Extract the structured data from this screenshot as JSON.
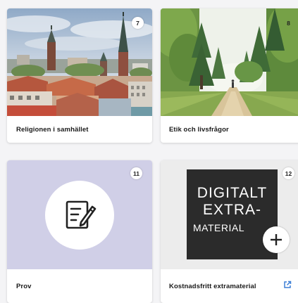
{
  "cards": [
    {
      "number": "7",
      "title": "Religionen i samhället",
      "image": "city-skyline-photo"
    },
    {
      "number": "8",
      "title": "Etik och livsfrågor",
      "image": "forest-path-photo"
    },
    {
      "number": "11",
      "title": "Prov",
      "icon": "exam-edit-icon",
      "media_color": "#d0cfe7"
    },
    {
      "number": "12",
      "title": "Kostnadsfritt extramaterial",
      "badge": {
        "line1": "DIGITALT",
        "line2": "EXTRA-",
        "line3": "MATERIAL"
      },
      "plus_icon": "plus-icon",
      "link_icon": "external-link-icon",
      "link_color": "#3d7fd6"
    }
  ]
}
